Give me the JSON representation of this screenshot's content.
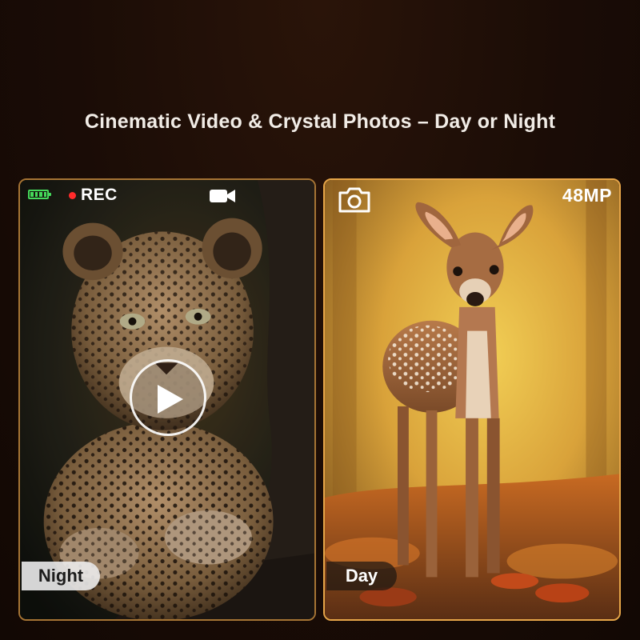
{
  "headline": "Cinematic Video & Crystal Photos – Day or Night",
  "night_panel": {
    "battery_icon": "battery-full-icon",
    "battery_color": "#45d85a",
    "rec_label": "REC",
    "rec_color": "#ff2b2b",
    "video_icon": "video-camera-icon",
    "play_icon": "play-icon",
    "subject": "leopard-image",
    "mode_label": "Night"
  },
  "day_panel": {
    "camera_icon": "camera-icon",
    "resolution_label": "48MP",
    "subject": "fawn-deer-image",
    "mode_label": "Day"
  },
  "colors": {
    "background": "#1a0c06",
    "panel_border_night": "#a67434",
    "panel_border_day": "#e6a548"
  }
}
